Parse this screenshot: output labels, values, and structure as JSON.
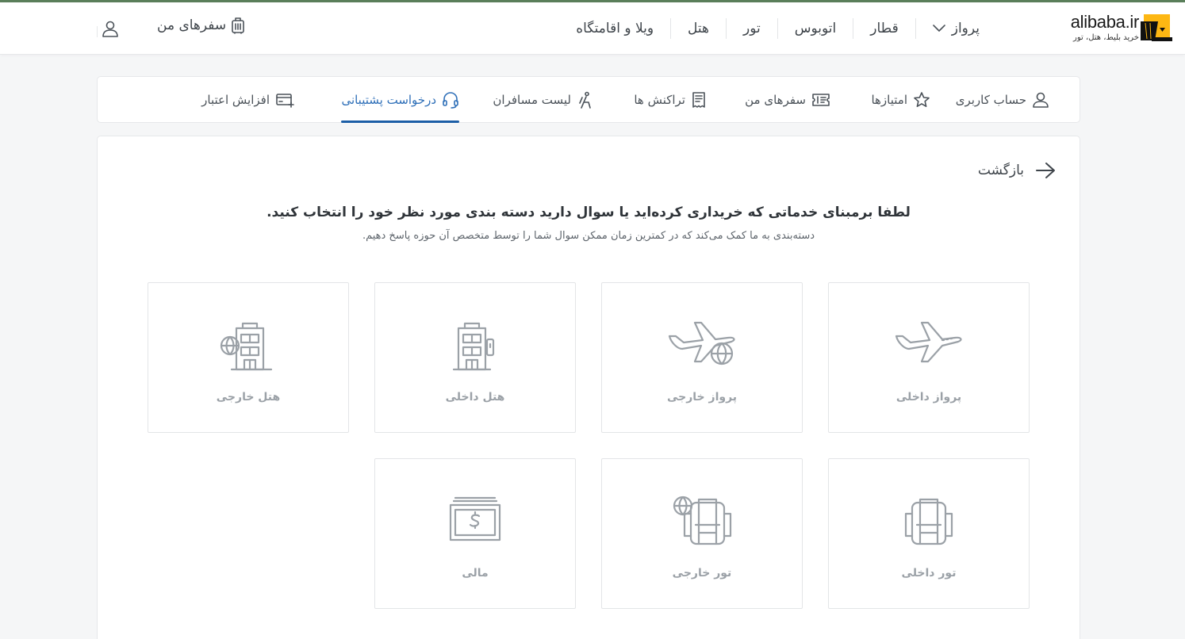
{
  "brand": {
    "name": "alibaba.ir",
    "tagline": "خرید بلیط، هتل، تور"
  },
  "nav": {
    "items": [
      {
        "label": "پرواز"
      },
      {
        "label": "قطار"
      },
      {
        "label": "اتوبوس"
      },
      {
        "label": "تور"
      },
      {
        "label": "هتل"
      },
      {
        "label": "ویلا و اقامتگاه"
      }
    ],
    "my_trips": "سفرهای من"
  },
  "tabs": [
    {
      "label": "حساب کاربری"
    },
    {
      "label": "امتیازها"
    },
    {
      "label": "سفرهای من"
    },
    {
      "label": "تراکنش ها"
    },
    {
      "label": "لیست مسافران"
    },
    {
      "label": "درخواست پشتیبانی",
      "active": true
    },
    {
      "label": "افزایش اعتبار"
    }
  ],
  "content": {
    "back_label": "بازگشت",
    "heading": "لطفا برمبنای خدماتی که خریداری کرده‌اید یا سوال دارید دسته بندی مورد نظر خود را انتخاب کنید.",
    "subheading": "دسته‌بندی به ما کمک می‌کند که در کمترین زمان ممکن سوال شما را توسط متخصص آن حوزه پاسخ دهیم.",
    "categories": [
      {
        "label": "پرواز داخلی",
        "icon": "plane-icon"
      },
      {
        "label": "پرواز خارجی",
        "icon": "plane-globe-icon"
      },
      {
        "label": "هتل داخلی",
        "icon": "hotel-icon"
      },
      {
        "label": "هتل خارجی",
        "icon": "hotel-globe-icon"
      },
      {
        "label": "تور داخلی",
        "icon": "backpack-icon"
      },
      {
        "label": "تور خارجی",
        "icon": "backpack-globe-icon"
      },
      {
        "label": "مالی",
        "icon": "money-icon"
      }
    ]
  },
  "colors": {
    "accent": "#1c5ea6",
    "icon": "#9ba1a7",
    "topline": "#5a7f5a"
  }
}
